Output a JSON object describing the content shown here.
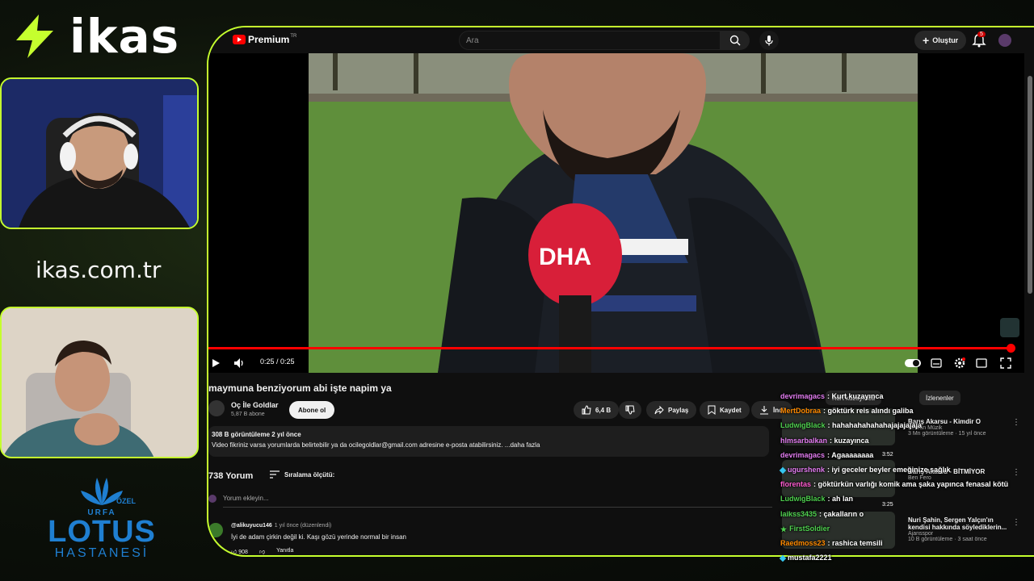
{
  "overlay": {
    "sponsor_name": "ikas",
    "sponsor_url": "ikas.com.tr",
    "hospital": {
      "small": "ÖZEL",
      "city": "URFA",
      "name": "LOTUS",
      "sub": "HASTANESİ"
    }
  },
  "youtube": {
    "brand": "Premium",
    "brand_tm": "TR",
    "search_placeholder": "Ara",
    "create_label": "Oluştur",
    "notif_count": "5",
    "player": {
      "time": "0:25 / 0:25",
      "progress": 1.0
    },
    "video": {
      "title": "maymuna benziyorum abi işte napim ya",
      "channel": "Oç İle Goldlar",
      "subscribers": "5,87 B abone",
      "subscribe_label": "Abone ol",
      "likes": "6,4 B",
      "share_label": "Paylaş",
      "save_label": "Kaydet",
      "download_label": "İndi",
      "description_meta": "308 B görüntüleme  2 yıl önce",
      "description_text": "Video fikriniz varsa yorumlarda belirtebilir ya da ocilegoldlar@gmail.com adresine e-posta atabilirsiniz. ...daha fazla"
    },
    "comments": {
      "count_label": "738 Yorum",
      "sort_label": "Sıralama ölçütü:",
      "add_placeholder": "Yorum ekleyin...",
      "first": {
        "user": "@alikuyucu146",
        "time": "1 yıl önce (düzenlendi)",
        "text": "İyi de adam çirkin değil ki.  Kaşı gözü yerinde normal bir insan",
        "likes": "908",
        "reply_label": "Yanıtla"
      }
    },
    "chips": [
      "Kurt kuzayınca",
      "İzlenenler"
    ],
    "recommendations": [
      {
        "title": "Barış Akarsu - Kimdir O",
        "meta": "Kervan Müzik",
        "stats": "3 Mn görüntüleme · 15 yıl önce",
        "duration": "3:52"
      },
      {
        "title": "Barış Akarsu - BİTMİYOR",
        "meta": "Ben Fero",
        "stats": "",
        "duration": "3:25"
      },
      {
        "title": "Nuri Şahin, Sergen Yalçın'ın kendisi hakkında söylediklerin...",
        "meta": "Ajansspor",
        "stats": "10 B görüntüleme · 3 saat önce",
        "duration": ""
      }
    ]
  },
  "chat": [
    {
      "user": "devrimagacs",
      "msg": "Kurt kuzayınca",
      "color": "#e27cf0",
      "icon": ""
    },
    {
      "user": "MertDobraa",
      "msg": "göktürk reis alındı galiba",
      "color": "#ff8a00",
      "icon": ""
    },
    {
      "user": "LudwigBlack",
      "msg": "hahahahahahahajajajajaja",
      "color": "#4fd04f",
      "icon": ""
    },
    {
      "user": "hlmsarbalkan",
      "msg": "kuzayınca",
      "color": "#e27cf0",
      "icon": ""
    },
    {
      "user": "devrimagacs",
      "msg": "Agaaaaaaaa",
      "color": "#e27cf0",
      "icon": ""
    },
    {
      "user": "ugurshenk",
      "msg": "iyi geceler beyler emeğinize sağlık",
      "color": "#e27cf0",
      "icon": "diamond-icon"
    },
    {
      "user": "florentas",
      "msg": "göktürkün varlığı komik ama şaka yapınca fenasal kötü",
      "color": "#ff5bd0",
      "icon": ""
    },
    {
      "user": "LudwigBlack",
      "msg": "ah lan",
      "color": "#4fd04f",
      "icon": ""
    },
    {
      "user": "laikss3435",
      "msg": "çakalların o",
      "color": "#4fd04f",
      "icon": ""
    },
    {
      "user": "FirstSoldier",
      "msg": "",
      "color": "#4fd04f",
      "icon": "star-icon"
    },
    {
      "user": "Raedmoss23",
      "msg": "rashica temsili",
      "color": "#ff8a00",
      "icon": ""
    },
    {
      "user": "mustafa2221",
      "msg": "",
      "color": "#ffffff",
      "icon": "diamond-icon"
    }
  ]
}
